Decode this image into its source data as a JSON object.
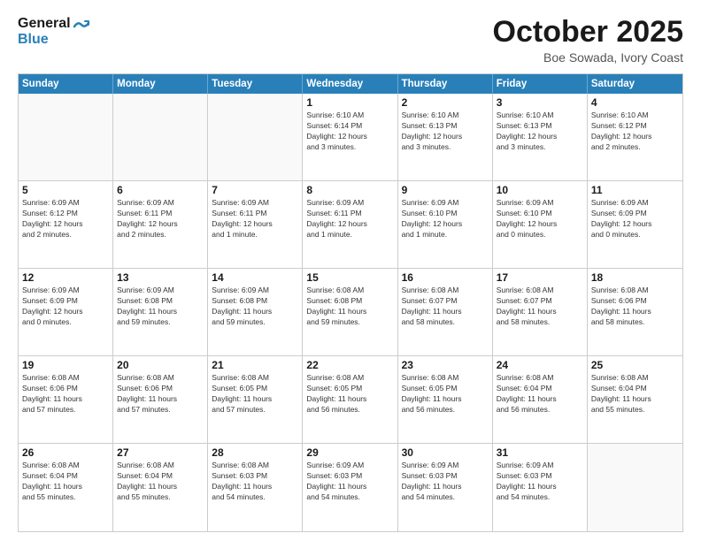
{
  "header": {
    "logo_line1": "General",
    "logo_line2": "Blue",
    "month": "October 2025",
    "location": "Boe Sowada, Ivory Coast"
  },
  "weekdays": [
    "Sunday",
    "Monday",
    "Tuesday",
    "Wednesday",
    "Thursday",
    "Friday",
    "Saturday"
  ],
  "rows": [
    [
      {
        "day": "",
        "info": ""
      },
      {
        "day": "",
        "info": ""
      },
      {
        "day": "",
        "info": ""
      },
      {
        "day": "1",
        "info": "Sunrise: 6:10 AM\nSunset: 6:14 PM\nDaylight: 12 hours\nand 3 minutes."
      },
      {
        "day": "2",
        "info": "Sunrise: 6:10 AM\nSunset: 6:13 PM\nDaylight: 12 hours\nand 3 minutes."
      },
      {
        "day": "3",
        "info": "Sunrise: 6:10 AM\nSunset: 6:13 PM\nDaylight: 12 hours\nand 3 minutes."
      },
      {
        "day": "4",
        "info": "Sunrise: 6:10 AM\nSunset: 6:12 PM\nDaylight: 12 hours\nand 2 minutes."
      }
    ],
    [
      {
        "day": "5",
        "info": "Sunrise: 6:09 AM\nSunset: 6:12 PM\nDaylight: 12 hours\nand 2 minutes."
      },
      {
        "day": "6",
        "info": "Sunrise: 6:09 AM\nSunset: 6:11 PM\nDaylight: 12 hours\nand 2 minutes."
      },
      {
        "day": "7",
        "info": "Sunrise: 6:09 AM\nSunset: 6:11 PM\nDaylight: 12 hours\nand 1 minute."
      },
      {
        "day": "8",
        "info": "Sunrise: 6:09 AM\nSunset: 6:11 PM\nDaylight: 12 hours\nand 1 minute."
      },
      {
        "day": "9",
        "info": "Sunrise: 6:09 AM\nSunset: 6:10 PM\nDaylight: 12 hours\nand 1 minute."
      },
      {
        "day": "10",
        "info": "Sunrise: 6:09 AM\nSunset: 6:10 PM\nDaylight: 12 hours\nand 0 minutes."
      },
      {
        "day": "11",
        "info": "Sunrise: 6:09 AM\nSunset: 6:09 PM\nDaylight: 12 hours\nand 0 minutes."
      }
    ],
    [
      {
        "day": "12",
        "info": "Sunrise: 6:09 AM\nSunset: 6:09 PM\nDaylight: 12 hours\nand 0 minutes."
      },
      {
        "day": "13",
        "info": "Sunrise: 6:09 AM\nSunset: 6:08 PM\nDaylight: 11 hours\nand 59 minutes."
      },
      {
        "day": "14",
        "info": "Sunrise: 6:09 AM\nSunset: 6:08 PM\nDaylight: 11 hours\nand 59 minutes."
      },
      {
        "day": "15",
        "info": "Sunrise: 6:08 AM\nSunset: 6:08 PM\nDaylight: 11 hours\nand 59 minutes."
      },
      {
        "day": "16",
        "info": "Sunrise: 6:08 AM\nSunset: 6:07 PM\nDaylight: 11 hours\nand 58 minutes."
      },
      {
        "day": "17",
        "info": "Sunrise: 6:08 AM\nSunset: 6:07 PM\nDaylight: 11 hours\nand 58 minutes."
      },
      {
        "day": "18",
        "info": "Sunrise: 6:08 AM\nSunset: 6:06 PM\nDaylight: 11 hours\nand 58 minutes."
      }
    ],
    [
      {
        "day": "19",
        "info": "Sunrise: 6:08 AM\nSunset: 6:06 PM\nDaylight: 11 hours\nand 57 minutes."
      },
      {
        "day": "20",
        "info": "Sunrise: 6:08 AM\nSunset: 6:06 PM\nDaylight: 11 hours\nand 57 minutes."
      },
      {
        "day": "21",
        "info": "Sunrise: 6:08 AM\nSunset: 6:05 PM\nDaylight: 11 hours\nand 57 minutes."
      },
      {
        "day": "22",
        "info": "Sunrise: 6:08 AM\nSunset: 6:05 PM\nDaylight: 11 hours\nand 56 minutes."
      },
      {
        "day": "23",
        "info": "Sunrise: 6:08 AM\nSunset: 6:05 PM\nDaylight: 11 hours\nand 56 minutes."
      },
      {
        "day": "24",
        "info": "Sunrise: 6:08 AM\nSunset: 6:04 PM\nDaylight: 11 hours\nand 56 minutes."
      },
      {
        "day": "25",
        "info": "Sunrise: 6:08 AM\nSunset: 6:04 PM\nDaylight: 11 hours\nand 55 minutes."
      }
    ],
    [
      {
        "day": "26",
        "info": "Sunrise: 6:08 AM\nSunset: 6:04 PM\nDaylight: 11 hours\nand 55 minutes."
      },
      {
        "day": "27",
        "info": "Sunrise: 6:08 AM\nSunset: 6:04 PM\nDaylight: 11 hours\nand 55 minutes."
      },
      {
        "day": "28",
        "info": "Sunrise: 6:08 AM\nSunset: 6:03 PM\nDaylight: 11 hours\nand 54 minutes."
      },
      {
        "day": "29",
        "info": "Sunrise: 6:09 AM\nSunset: 6:03 PM\nDaylight: 11 hours\nand 54 minutes."
      },
      {
        "day": "30",
        "info": "Sunrise: 6:09 AM\nSunset: 6:03 PM\nDaylight: 11 hours\nand 54 minutes."
      },
      {
        "day": "31",
        "info": "Sunrise: 6:09 AM\nSunset: 6:03 PM\nDaylight: 11 hours\nand 54 minutes."
      },
      {
        "day": "",
        "info": ""
      }
    ]
  ]
}
